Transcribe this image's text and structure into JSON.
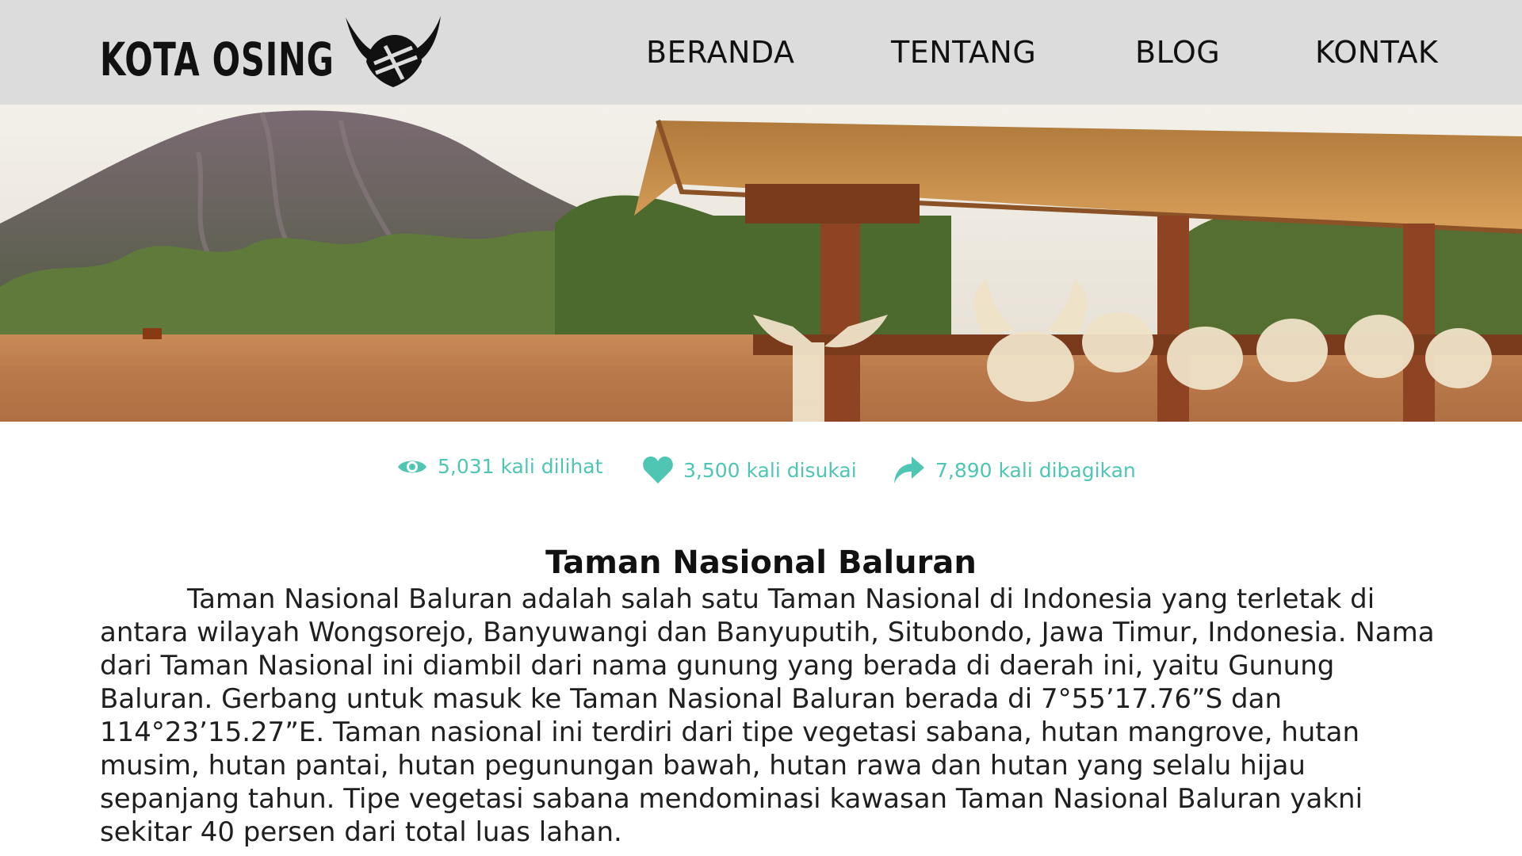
{
  "brand": {
    "name": "KOTA OSING",
    "logo_icon": "horned-helmet-icon"
  },
  "nav": {
    "items": [
      {
        "label": "BERANDA"
      },
      {
        "label": "TENTANG"
      },
      {
        "label": "BLOG"
      },
      {
        "label": "KONTAK"
      }
    ]
  },
  "hero": {
    "icon": "baluran-landscape-photo"
  },
  "stats": {
    "views": {
      "icon": "eye-icon",
      "text": "5,031 kali dilihat"
    },
    "likes": {
      "icon": "heart-icon",
      "text": "3,500 kali disukai"
    },
    "shares": {
      "icon": "share-arrow-icon",
      "text": "7,890 kali dibagikan"
    }
  },
  "article": {
    "title": "Taman Nasional Baluran",
    "body": "Taman Nasional Baluran adalah salah satu Taman Nasional di Indonesia yang terletak di antara wilayah Wongsorejo, Banyuwangi dan Banyuputih, Situbondo, Jawa Timur, Indonesia. Nama dari Taman Nasional ini diambil dari nama gunung yang berada di daerah ini, yaitu Gunung Baluran. Gerbang untuk masuk ke Taman Nasional Baluran berada di 7°55’17.76”S dan 114°23’15.27”E. Taman nasional ini terdiri dari tipe vegetasi sabana, hutan mangrove, hutan musim, hutan pantai, hutan pegunungan bawah, hutan rawa dan hutan yang selalu hijau sepanjang tahun. Tipe vegetasi sabana mendominasi kawasan Taman Nasional Baluran yakni sekitar 40 persen dari total luas lahan."
  },
  "colors": {
    "header_bg": "#dcdcdc",
    "accent": "#4fc6b3",
    "text": "#1a1a1a"
  }
}
